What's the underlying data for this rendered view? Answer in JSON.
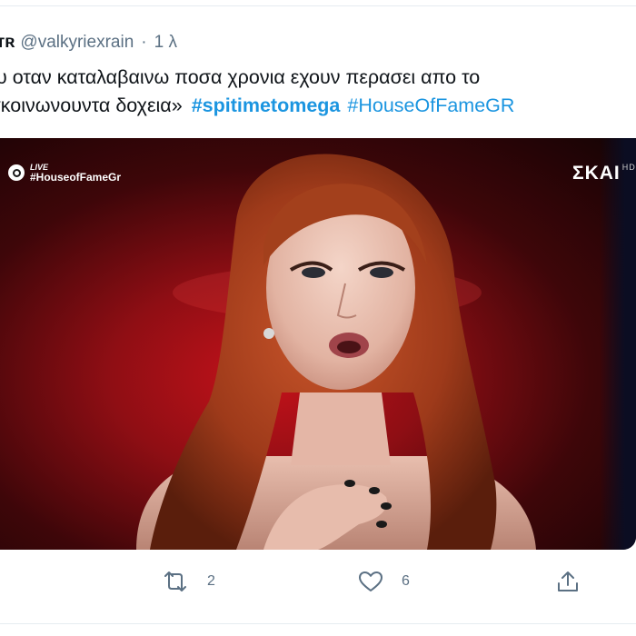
{
  "tweet": {
    "name_fragment": "тʀ",
    "handle": "@valkyriexrain",
    "separator": "·",
    "time": "1 λ",
    "text_line1": "υ οταν καταλαβαινω ποσα χρονια εχουν περασει απο το",
    "text_line2": "γκοινωνουντα δοχεια»",
    "hashtag1": "#spitimetomega",
    "hashtag2": "#HouseOfFameGR"
  },
  "media": {
    "live_label": "LIVE",
    "live_hashtag": "#HouseofFameGr",
    "channel_logo": "ΣΚΑΙ",
    "channel_suffix": "HD"
  },
  "actions": {
    "retweet_icon": "retweet-icon",
    "retweet_count": "2",
    "like_icon": "heart-icon",
    "like_count": "6",
    "share_icon": "share-icon"
  },
  "colors": {
    "hashtag": "#1b95e0",
    "secondary_text": "#5b7083",
    "primary_text": "#0f1419"
  }
}
